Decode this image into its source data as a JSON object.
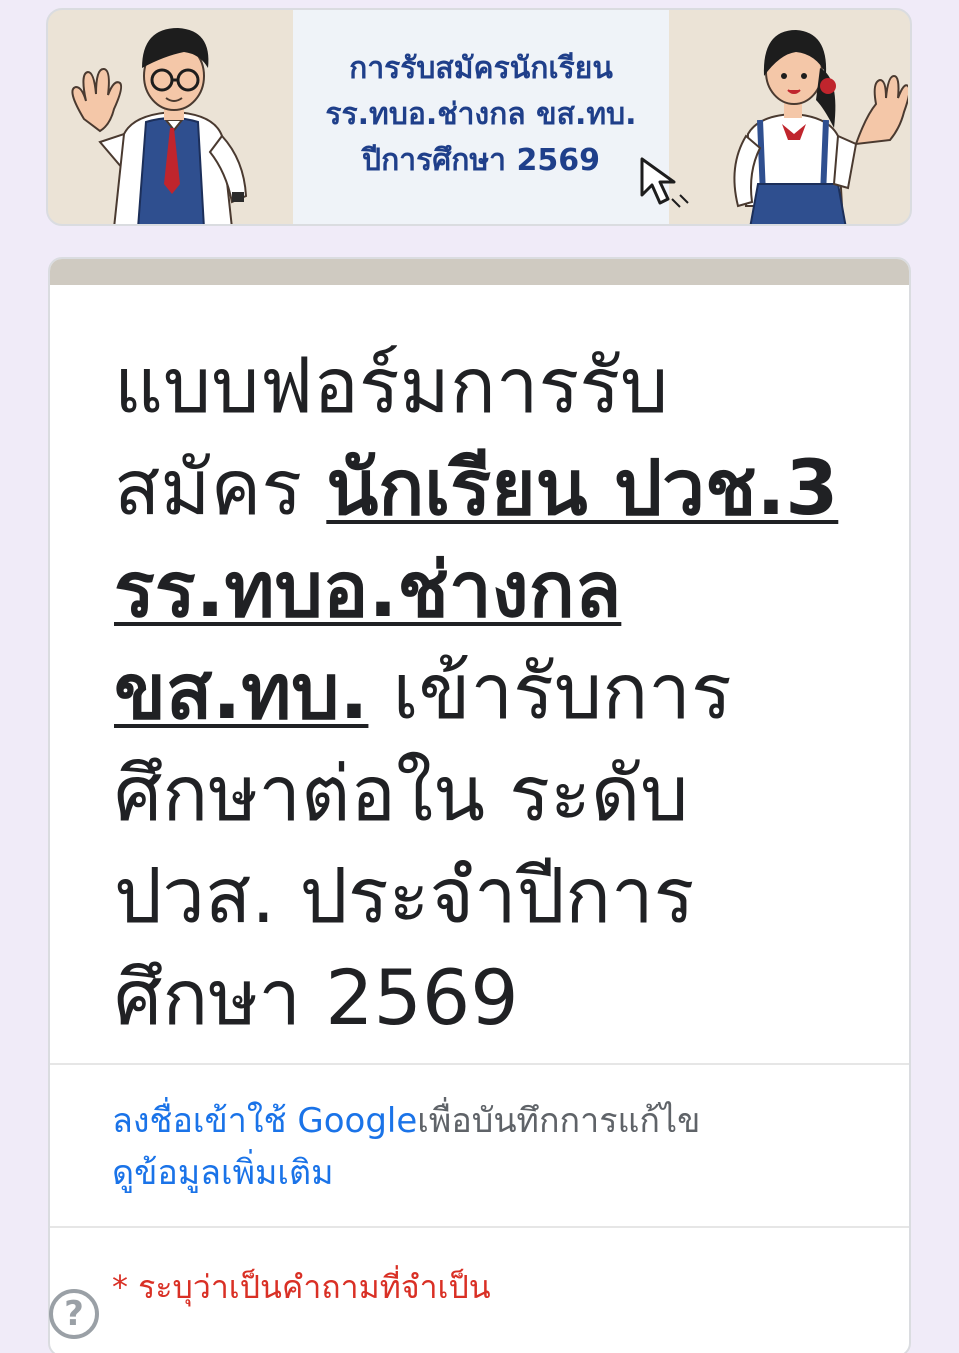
{
  "banner": {
    "line1": "การรับสมัครนักเรียน",
    "line2": "รร.ทบอ.ช่างกล ขส.ทบ.",
    "line3": "ปีการศึกษา 2569"
  },
  "form": {
    "title_part1": "แบบฟอร์มการรับสมัคร ",
    "title_emphasis": "นักเรียน ปวช.3 รร.ทบอ.ช่างกล ขส.ทบ.",
    "title_part2": " เข้ารับการศึกษาต่อใน ระดับ ปวส. ประจำปีการศึกษา 2569"
  },
  "signin": {
    "link_text": "ลงชื่อเข้าใช้ Google",
    "suffix_text": "เพื่อบันทึกการแก้ไข",
    "learn_more": "ดูข้อมูลเพิ่มเติม"
  },
  "required_note": "* ระบุว่าเป็นคำถามที่จำเป็น",
  "help_button": "?",
  "colors": {
    "banner_text": "#1f3f8a",
    "link": "#1a73e8",
    "required": "#d93025",
    "card_accent": "#cfcac1"
  },
  "icons": [
    "boy-illustration",
    "girl-illustration",
    "cursor-icon",
    "help-icon"
  ]
}
